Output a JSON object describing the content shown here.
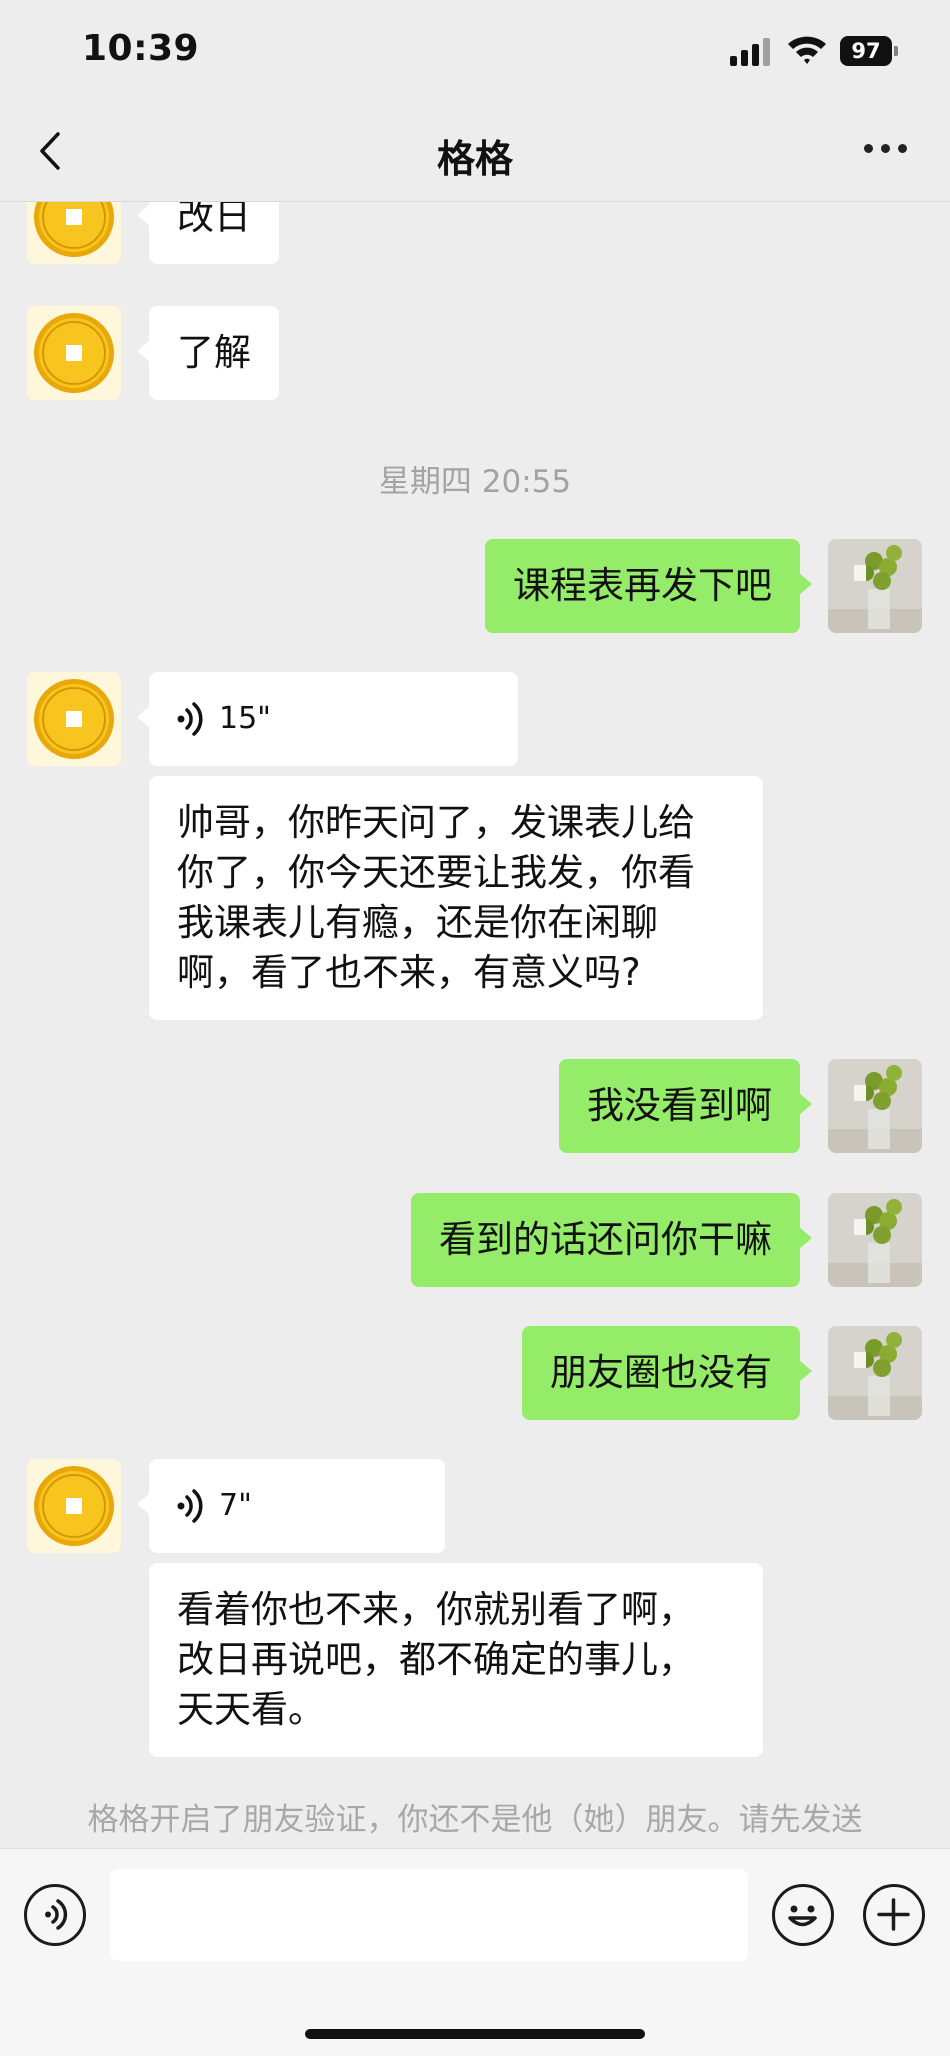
{
  "status_bar": {
    "time": "10:39",
    "battery": "97"
  },
  "nav": {
    "title": "格格"
  },
  "messages": {
    "m1": "改日",
    "m2": "了解",
    "timestamp": "星期四 20:55",
    "m3": "课程表再发下吧",
    "voice1": "15\"",
    "m4": "帅哥，你昨天问了，发课表儿给\n你了，你今天还要让我发，你看\n我课表儿有瘾，还是你在闲聊\n啊，看了也不来，有意义吗?",
    "m5": "我没看到啊",
    "m6": "看到的话还问你干嘛",
    "m7": "朋友圈也没有",
    "voice2": "7\"",
    "m8": "看着你也不来，你就别看了啊，\n改日再说吧，都不确定的事儿，\n天天看。",
    "system_notice": "格格开启了朋友验证，你还不是他（她）朋友。请先发送"
  },
  "colors": {
    "sent_bubble": "#95ec69",
    "received_bubble": "#ffffff",
    "background": "#ededed"
  },
  "icons": {
    "back": "chevron-left-icon",
    "more": "more-icon",
    "voice_mode": "voice-mode-icon",
    "emoji": "emoji-icon",
    "add": "plus-icon"
  }
}
